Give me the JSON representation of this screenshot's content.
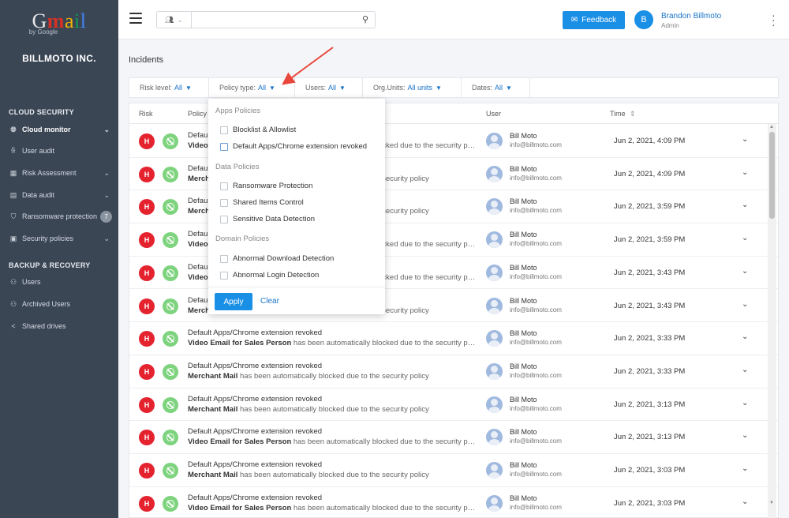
{
  "brand": {
    "logo_g": "G",
    "logo_m": "m",
    "logo_a": "a",
    "logo_i": "i",
    "logo_l": "l",
    "by_google": "by Google",
    "company": "BILLMOTO INC."
  },
  "sidebar": {
    "cloud_title": "CLOUD SECURITY",
    "cloud_items": [
      {
        "label": "Cloud monitor",
        "icon": "globe-icon"
      },
      {
        "label": "User audit",
        "icon": "user-icon"
      },
      {
        "label": "Risk Assessment",
        "icon": "grid-icon"
      },
      {
        "label": "Data audit",
        "icon": "document-icon"
      },
      {
        "label": "Ransomware protection",
        "icon": "shield-icon",
        "badge": "7"
      },
      {
        "label": "Security policies",
        "icon": "policy-icon"
      }
    ],
    "backup_title": "BACKUP & RECOVERY",
    "backup_items": [
      {
        "label": "Users",
        "icon": "users-icon"
      },
      {
        "label": "Archived Users",
        "icon": "archived-users-icon"
      },
      {
        "label": "Shared drives",
        "icon": "share-icon"
      }
    ]
  },
  "header": {
    "search_placeholder": "",
    "feedback_label": "Feedback",
    "avatar_initial": "B",
    "user_name": "Brandon Billmoto",
    "user_role": "Admin"
  },
  "page": {
    "title": "Incidents"
  },
  "filters": [
    {
      "label": "Risk level:",
      "value": "All"
    },
    {
      "label": "Policy type:",
      "value": "All"
    },
    {
      "label": "Users:",
      "value": "All"
    },
    {
      "label": "Org.Units:",
      "value": "All units"
    },
    {
      "label": "Dates:",
      "value": "All"
    }
  ],
  "table": {
    "columns": {
      "risk": "Risk",
      "policy": "Policy",
      "user": "User",
      "time": "Time"
    },
    "sort_glyph": "⇕",
    "rows": [
      {
        "risk": "H",
        "policy": "Default Apps/Chrome extension revoked",
        "target": "Video Email for Sales Person",
        "message": " has been automatically blocked due to the security policy",
        "user": "Bill Moto",
        "email": "info@billmoto.com",
        "time": "Jun 2, 2021, 4:09 PM"
      },
      {
        "risk": "H",
        "policy": "Default Apps/Chrome extension revoked",
        "target": "Merchant Mail",
        "message": " has been automatically blocked due to the security policy",
        "user": "Bill Moto",
        "email": "info@billmoto.com",
        "time": "Jun 2, 2021, 4:09 PM"
      },
      {
        "risk": "H",
        "policy": "Default Apps/Chrome extension revoked",
        "target": "Merchant Mail",
        "message": " has been automatically blocked due to the security policy",
        "user": "Bill Moto",
        "email": "info@billmoto.com",
        "time": "Jun 2, 2021, 3:59 PM"
      },
      {
        "risk": "H",
        "policy": "Default Apps/Chrome extension revoked",
        "target": "Video Email for Sales Person",
        "message": " has been automatically blocked due to the security policy",
        "user": "Bill Moto",
        "email": "info@billmoto.com",
        "time": "Jun 2, 2021, 3:59 PM"
      },
      {
        "risk": "H",
        "policy": "Default Apps/Chrome extension revoked",
        "target": "Video Email for Sales Person",
        "message": " has been automatically blocked due to the security policy",
        "user": "Bill Moto",
        "email": "info@billmoto.com",
        "time": "Jun 2, 2021, 3:43 PM"
      },
      {
        "risk": "H",
        "policy": "Default Apps/Chrome extension revoked",
        "target": "Merchant Mail",
        "message": " has been automatically blocked due to the security policy",
        "user": "Bill Moto",
        "email": "info@billmoto.com",
        "time": "Jun 2, 2021, 3:43 PM"
      },
      {
        "risk": "H",
        "policy": "Default Apps/Chrome extension revoked",
        "target": "Video Email for Sales Person",
        "message": " has been automatically blocked due to the security policy",
        "user": "Bill Moto",
        "email": "info@billmoto.com",
        "time": "Jun 2, 2021, 3:33 PM"
      },
      {
        "risk": "H",
        "policy": "Default Apps/Chrome extension revoked",
        "target": "Merchant Mail",
        "message": " has been automatically blocked due to the security policy",
        "user": "Bill Moto",
        "email": "info@billmoto.com",
        "time": "Jun 2, 2021, 3:33 PM"
      },
      {
        "risk": "H",
        "policy": "Default Apps/Chrome extension revoked",
        "target": "Merchant Mail",
        "message": " has been automatically blocked due to the security policy",
        "user": "Bill Moto",
        "email": "info@billmoto.com",
        "time": "Jun 2, 2021, 3:13 PM"
      },
      {
        "risk": "H",
        "policy": "Default Apps/Chrome extension revoked",
        "target": "Video Email for Sales Person",
        "message": " has been automatically blocked due to the security policy",
        "user": "Bill Moto",
        "email": "info@billmoto.com",
        "time": "Jun 2, 2021, 3:13 PM"
      },
      {
        "risk": "H",
        "policy": "Default Apps/Chrome extension revoked",
        "target": "Merchant Mail",
        "message": " has been automatically blocked due to the security policy",
        "user": "Bill Moto",
        "email": "info@billmoto.com",
        "time": "Jun 2, 2021, 3:03 PM"
      },
      {
        "risk": "H",
        "policy": "Default Apps/Chrome extension revoked",
        "target": "Video Email for Sales Person",
        "message": " has been automatically blocked due to the security policy",
        "user": "Bill Moto",
        "email": "info@billmoto.com",
        "time": "Jun 2, 2021, 3:03 PM"
      }
    ]
  },
  "dropdown": {
    "sections": [
      {
        "title": "Apps Policies",
        "options": [
          "Blocklist & Allowlist",
          "Default Apps/Chrome extension revoked"
        ]
      },
      {
        "title": "Data Policies",
        "options": [
          "Ransomware Protection",
          "Shared Items Control",
          "Sensitive Data Detection"
        ]
      },
      {
        "title": "Domain Policies",
        "options": [
          "Abnormal Download Detection",
          "Abnormal Login Detection"
        ]
      }
    ],
    "apply_label": "Apply",
    "clear_label": "Clear"
  },
  "colors": {
    "sidebar_bg": "#3b4655",
    "accent": "#1a8fe6",
    "risk_high": "#e5232f",
    "status_ok": "#7ed37e",
    "annotation_arrow": "#e8473c"
  }
}
